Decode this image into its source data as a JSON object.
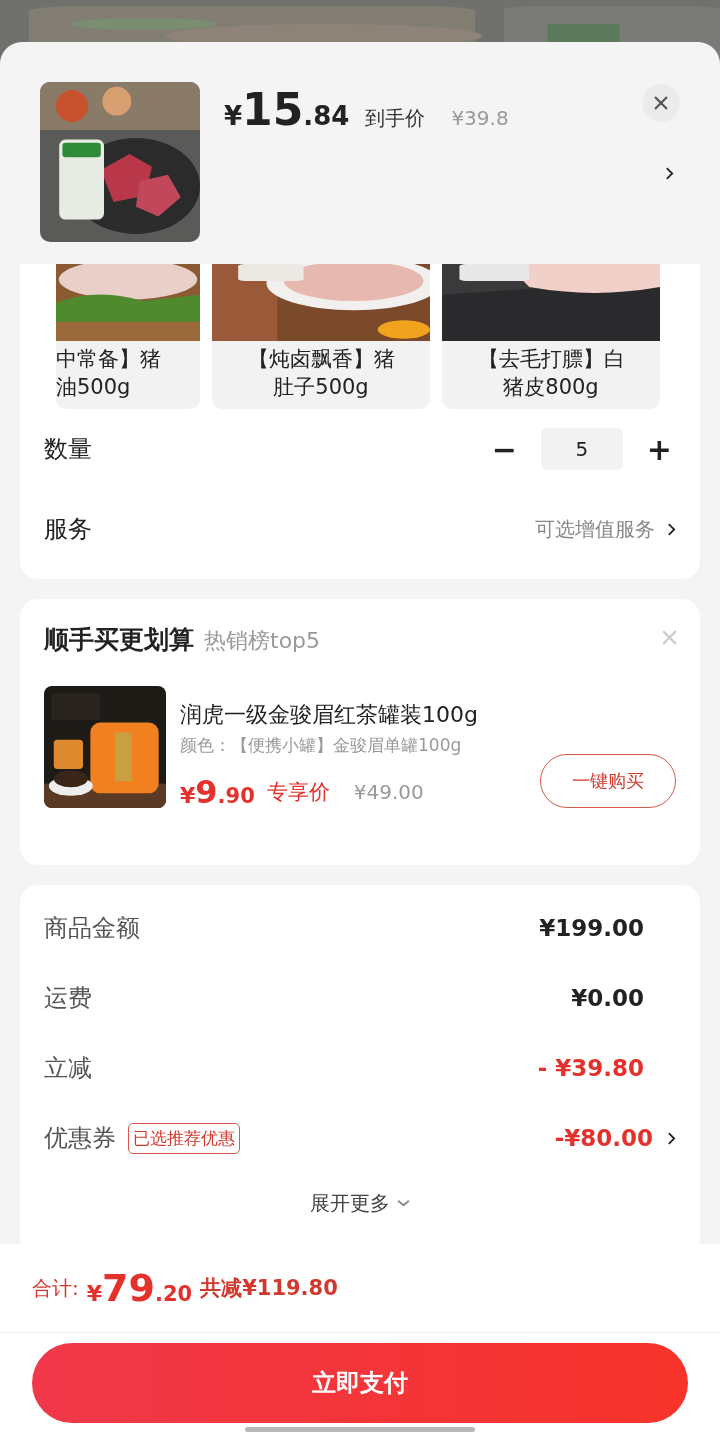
{
  "header": {
    "price_symbol": "¥",
    "price_int": "15",
    "price_dec": ".84",
    "price_label": "到手价",
    "original_price": "¥39.8"
  },
  "variants": [
    {
      "lines": [
        "中常备】猪",
        "油500g"
      ],
      "cut": true
    },
    {
      "lines": [
        "【炖卤飘香】猪",
        "肚子500g"
      ],
      "cut": false
    },
    {
      "lines": [
        "【去毛打膘】白",
        "猪皮800g"
      ],
      "cut": false
    }
  ],
  "quantity": {
    "label": "数量",
    "value": "5",
    "minus": "−",
    "plus": "+"
  },
  "service": {
    "label": "服务",
    "value": "可选增值服务"
  },
  "addon": {
    "title": "顺手买更划算",
    "subtitle": "热销榜top5",
    "product": {
      "name": "润虎一级金骏眉红茶罐装100g",
      "spec": "颜色：【便携小罐】金骏眉单罐100g",
      "price_symbol": "¥",
      "price_int": "9",
      "price_dec": ".90",
      "price_label": "专享价",
      "original_price": "¥49.00",
      "button": "一键购买"
    }
  },
  "summary": {
    "rows": [
      {
        "label": "商品金额",
        "value": "¥199.00",
        "discount": false,
        "chevron": false
      },
      {
        "label": "运费",
        "value": "¥0.00",
        "discount": false,
        "chevron": false
      },
      {
        "label": "立减",
        "value": "- ¥39.80",
        "discount": true,
        "chevron": false
      },
      {
        "label": "优惠券",
        "tag": "已选推荐优惠",
        "value": "-¥80.00",
        "discount": true,
        "chevron": true
      }
    ],
    "expand": "展开更多"
  },
  "total": {
    "label": "合计:",
    "symbol": "¥",
    "int": "79",
    "dec": ".20",
    "saved": "共减¥119.80"
  },
  "pay_button": "立即支付"
}
